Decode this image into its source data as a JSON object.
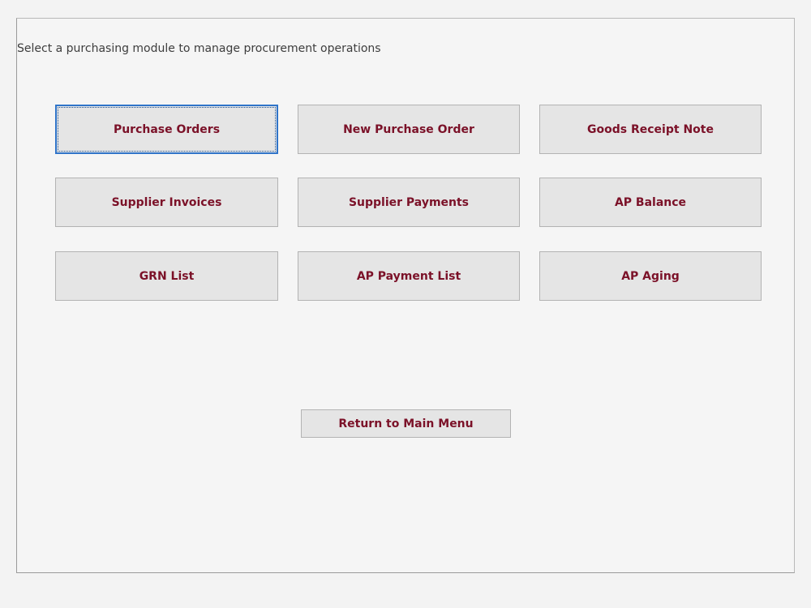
{
  "instruction": "Select a purchasing module to manage procurement operations",
  "modules": {
    "purchase_orders": "Purchase Orders",
    "new_purchase_order": "New Purchase Order",
    "goods_receipt_note": "Goods Receipt Note",
    "supplier_invoices": "Supplier Invoices",
    "supplier_payments": "Supplier Payments",
    "ap_balance": "AP Balance",
    "grn_list": "GRN List",
    "ap_payment_list": "AP Payment List",
    "ap_aging": "AP Aging"
  },
  "navigation": {
    "return_label": "Return to Main Menu"
  },
  "colors": {
    "button_text": "#7b1128",
    "button_face": "#e5e5e5",
    "focus_border": "#2f74c9",
    "background": "#f5f5f5"
  }
}
